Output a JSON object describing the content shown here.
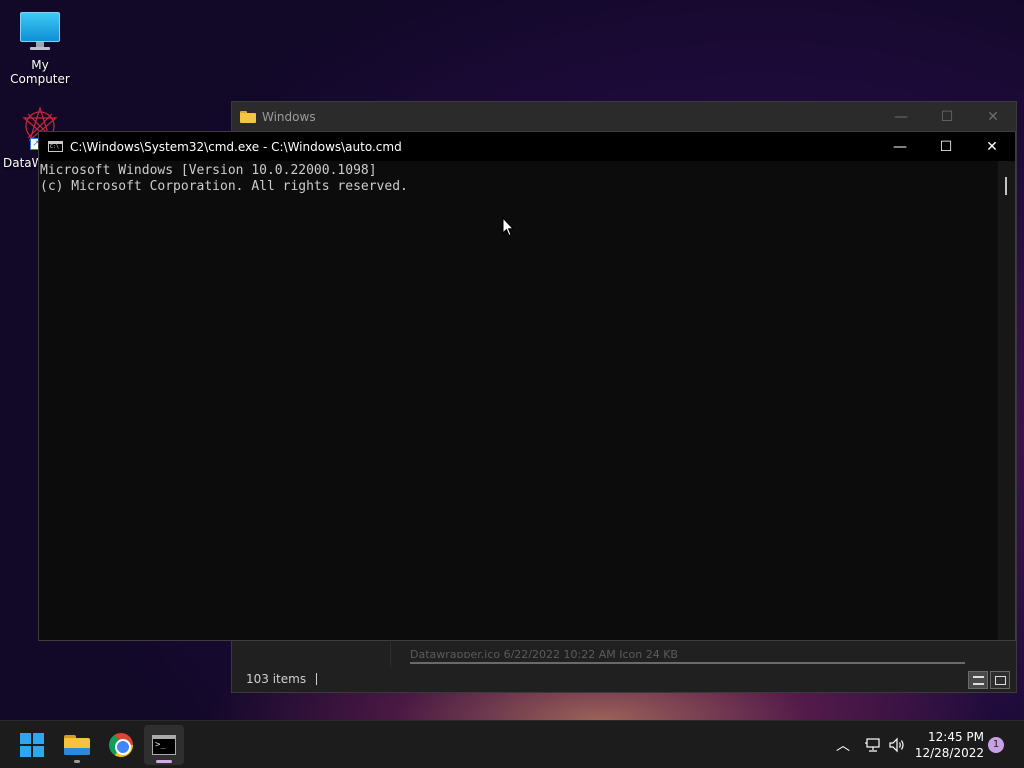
{
  "desktop": {
    "icons": [
      {
        "label": "My Computer",
        "icon": "monitor-icon"
      },
      {
        "label": "DataW",
        "icon": "datawrapper-icon"
      }
    ]
  },
  "explorer_window": {
    "title": "Windows",
    "peek_row": "Datawrapper.ico     6/22/2022 10:22 AM     Icon     24 KB",
    "status_items": "103 items"
  },
  "cmd_window": {
    "title": "C:\\Windows\\System32\\cmd.exe - C:\\Windows\\auto.cmd",
    "console_lines": [
      "Microsoft Windows [Version 10.0.22000.1098]",
      "(c) Microsoft Corporation. All rights reserved."
    ]
  },
  "taskbar": {
    "apps": [
      {
        "name": "Start",
        "icon": "windows-logo-icon"
      },
      {
        "name": "File Explorer",
        "icon": "file-explorer-icon"
      },
      {
        "name": "Google Chrome",
        "icon": "chrome-icon"
      },
      {
        "name": "Command Prompt",
        "icon": "terminal-icon"
      }
    ],
    "clock": {
      "time": "12:45 PM",
      "date": "12/28/2022"
    },
    "notification_count": "1"
  },
  "colors": {
    "accent": "#2ea6f0",
    "taskbar": "#1c1c1c",
    "console_bg": "#0c0c0c",
    "console_text": "#cccccc"
  }
}
